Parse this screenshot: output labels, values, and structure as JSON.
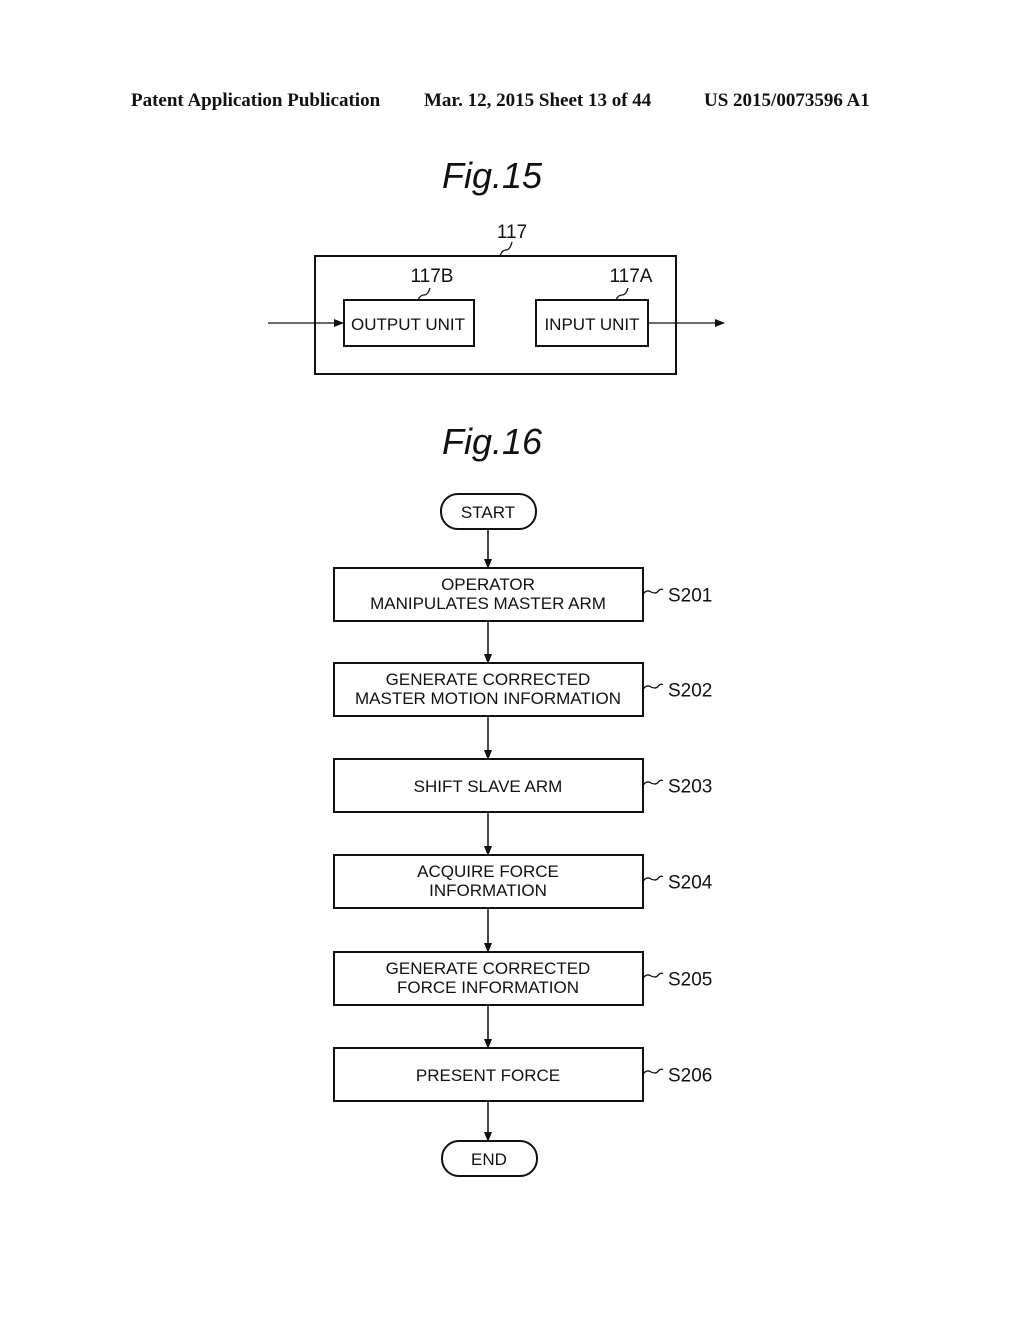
{
  "header": {
    "left": "Patent Application Publication",
    "middle": "Mar. 12, 2015  Sheet 13 of 44",
    "right": "US 2015/0073596 A1"
  },
  "fig15": {
    "title": "Fig.15",
    "container_ref": "117",
    "blocks": [
      {
        "ref": "117B",
        "label": "OUTPUT UNIT"
      },
      {
        "ref": "117A",
        "label": "INPUT UNIT"
      }
    ]
  },
  "fig16": {
    "title": "Fig.16",
    "start": "START",
    "end": "END",
    "steps": [
      {
        "id": "S201",
        "lines": [
          "OPERATOR",
          "MANIPULATES MASTER ARM"
        ]
      },
      {
        "id": "S202",
        "lines": [
          "GENERATE CORRECTED",
          "MASTER MOTION INFORMATION"
        ]
      },
      {
        "id": "S203",
        "lines": [
          "SHIFT SLAVE ARM"
        ]
      },
      {
        "id": "S204",
        "lines": [
          "ACQUIRE FORCE",
          "INFORMATION"
        ]
      },
      {
        "id": "S205",
        "lines": [
          "GENERATE CORRECTED",
          "FORCE INFORMATION"
        ]
      },
      {
        "id": "S206",
        "lines": [
          "PRESENT FORCE"
        ]
      }
    ]
  }
}
